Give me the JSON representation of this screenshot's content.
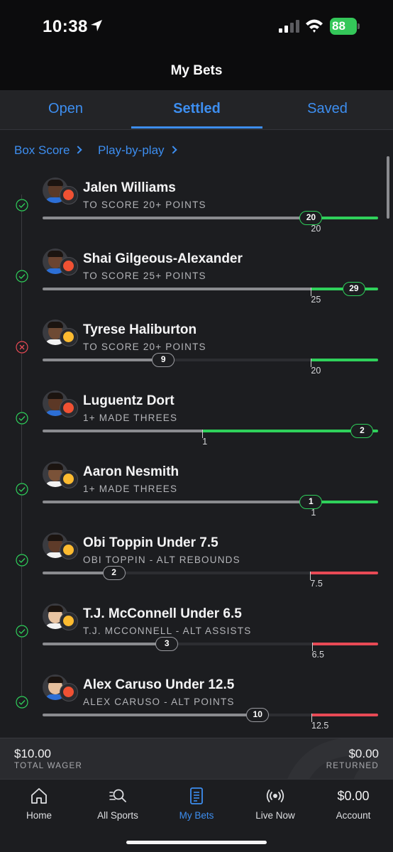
{
  "status_bar": {
    "time": "10:38",
    "battery": "88"
  },
  "header": {
    "title": "My Bets"
  },
  "tabs": [
    {
      "label": "Open",
      "active": false
    },
    {
      "label": "Settled",
      "active": true
    },
    {
      "label": "Saved",
      "active": false
    }
  ],
  "links": {
    "box_score": "Box Score",
    "play_by_play": "Play-by-play"
  },
  "colors": {
    "accent": "#3d8ef0",
    "win": "#2fd15b",
    "under": "#e84a55",
    "loss": "#e84a55"
  },
  "legs": [
    {
      "player": "Jalen Williams",
      "market": "TO SCORE 20+ POINTS",
      "result": "won",
      "type": "over",
      "actual": "20",
      "target": "20",
      "max": 25,
      "team": "OKC"
    },
    {
      "player": "Shai Gilgeous-Alexander",
      "market": "TO SCORE 25+ POINTS",
      "result": "won",
      "type": "over",
      "actual": "29",
      "target": "25",
      "max": 31.25,
      "team": "OKC"
    },
    {
      "player": "Tyrese Haliburton",
      "market": "TO SCORE 20+ POINTS",
      "result": "lost",
      "type": "over",
      "actual": "9",
      "target": "20",
      "max": 25,
      "team": "IND"
    },
    {
      "player": "Luguentz Dort",
      "market": "1+ MADE THREES",
      "result": "won",
      "type": "over",
      "actual": "2",
      "target": "1",
      "max": 2.1,
      "team": "OKC"
    },
    {
      "player": "Aaron Nesmith",
      "market": "1+ MADE THREES",
      "result": "won",
      "type": "over",
      "actual": "1",
      "target": "1",
      "max": 1.25,
      "team": "IND"
    },
    {
      "player": "Obi Toppin Under 7.5",
      "market": "OBI TOPPIN - ALT REBOUNDS",
      "result": "won",
      "type": "under",
      "actual": "2",
      "target": "7.5",
      "max": 9.4,
      "team": "IND"
    },
    {
      "player": "T.J. McConnell Under 6.5",
      "market": "T.J. MCCONNELL - ALT ASSISTS",
      "result": "won",
      "type": "under",
      "actual": "3",
      "target": "6.5",
      "max": 8.1,
      "team": "IND"
    },
    {
      "player": "Alex Caruso Under 12.5",
      "market": "ALEX CARUSO - ALT POINTS",
      "result": "won",
      "type": "under",
      "actual": "10",
      "target": "12.5",
      "max": 15.6,
      "team": "OKC"
    }
  ],
  "summary": {
    "wager_amount": "$10.00",
    "wager_label": "TOTAL WAGER",
    "returned_amount": "$0.00",
    "returned_label": "RETURNED"
  },
  "nav": {
    "items": [
      {
        "label": "Home",
        "icon": "home-icon",
        "active": false
      },
      {
        "label": "All Sports",
        "icon": "search-icon",
        "active": false
      },
      {
        "label": "My Bets",
        "icon": "bet-slip-icon",
        "active": true
      },
      {
        "label": "Live Now",
        "icon": "live-icon",
        "active": false
      },
      {
        "label": "Account",
        "icon": "account-icon",
        "active": false
      }
    ],
    "account_balance": "$0.00"
  }
}
